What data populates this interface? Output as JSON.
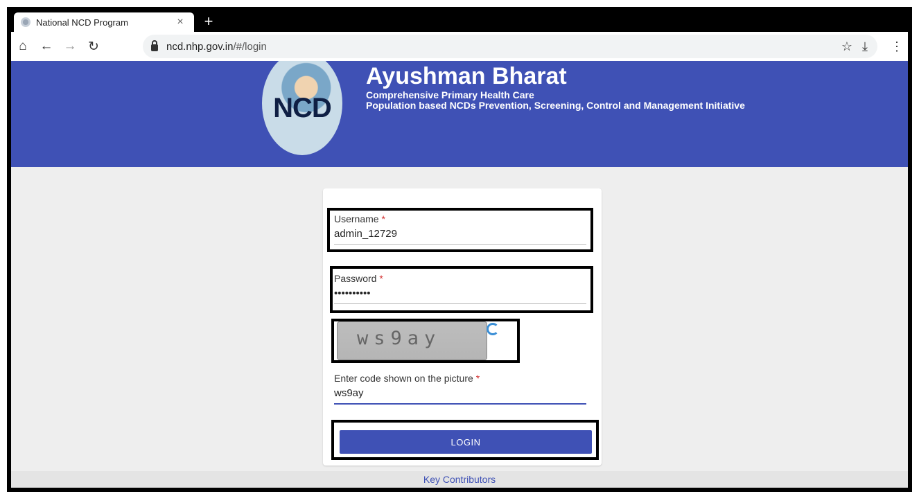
{
  "browser": {
    "tab_title": "National NCD Program",
    "tab_close": "×",
    "new_tab": "+",
    "url_host": "ncd.nhp.gov.in",
    "url_path": "/#/login"
  },
  "header": {
    "logo_text": "NCD",
    "title": "Ayushman Bharat",
    "subtitle1": "Comprehensive Primary Health Care",
    "subtitle2": "Population based NCDs Prevention, Screening, Control and Management Initiative"
  },
  "form": {
    "username_label": "Username",
    "username_value": "admin_12729",
    "password_label": "Password",
    "password_display": "••••••••••",
    "captcha_image_text": "ws9ay",
    "code_label": "Enter code shown on the picture",
    "code_value": "ws9ay",
    "required_mark": "*",
    "login_label": "LOGIN"
  },
  "footer": {
    "link": "Key Contributors"
  },
  "colors": {
    "primary": "#3f51b5",
    "required": "#d32f2f"
  }
}
